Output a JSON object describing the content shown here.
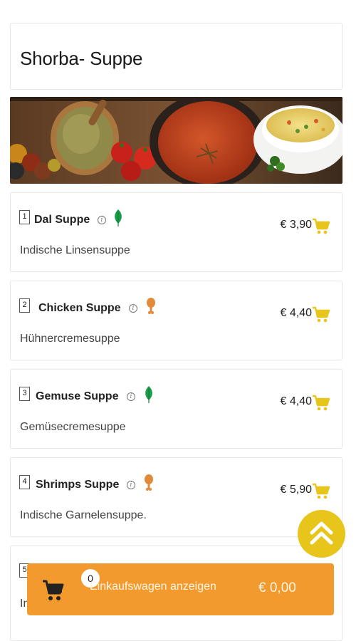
{
  "category": {
    "title": "Shorba- Suppe"
  },
  "banner": {
    "alt": ""
  },
  "items": [
    {
      "number": "1",
      "name": "Dal Suppe",
      "info": "i",
      "badge": "leaf-icon",
      "description": "Indische Linsensuppe",
      "price": "€ 3,90"
    },
    {
      "number": "2",
      "name": "Chicken Suppe",
      "info": "i",
      "badge": "chicken-leg-icon",
      "description": "Hühnercremesuppe",
      "price": "€ 4,40"
    },
    {
      "number": "3",
      "name": "Gemuse Suppe",
      "info": "i",
      "badge": "leaf-icon",
      "description": "Gemüsecremesuppe",
      "price": "€ 4,40"
    },
    {
      "number": "4",
      "name": "Shrimps Suppe",
      "info": "i",
      "badge": "chicken-leg-icon",
      "description": "Indische Garnelensuppe.",
      "price": "€ 5,90"
    },
    {
      "number": "5",
      "description_partial": "In"
    }
  ],
  "cart": {
    "count": "0",
    "label": "Einkaufswagen anzeigen",
    "total": "€ 0,00"
  },
  "colors": {
    "accent_yellow": "#e8c51b",
    "cart_orange": "#f39a2f",
    "veg_green": "#1a9c4a",
    "meat_orange": "#e08a3a"
  }
}
